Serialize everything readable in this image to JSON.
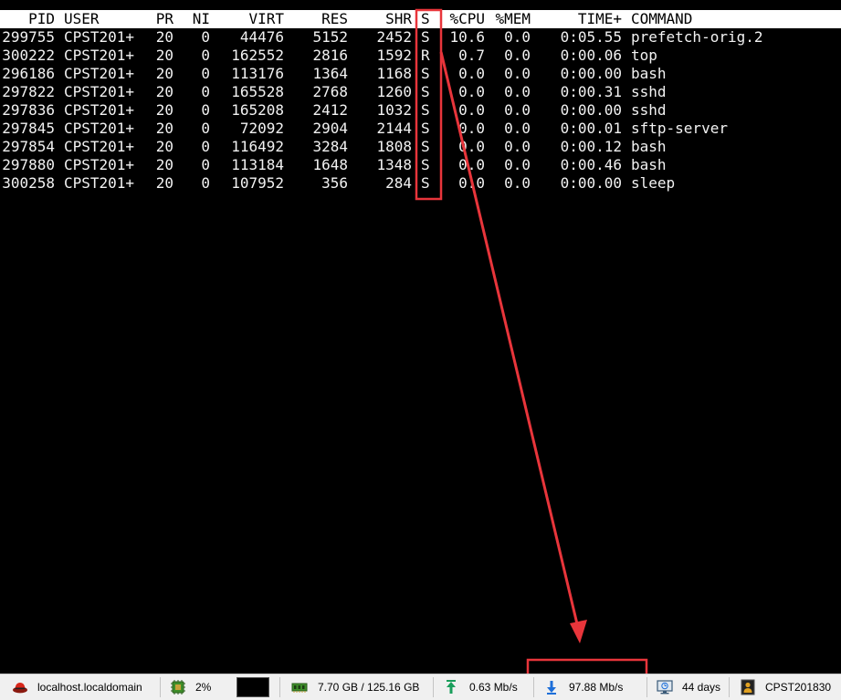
{
  "terminal": {
    "columns": [
      "PID",
      "USER",
      "PR",
      "NI",
      "VIRT",
      "RES",
      "SHR",
      "S",
      "%CPU",
      "%MEM",
      "TIME+",
      "COMMAND"
    ],
    "processes": [
      [
        "299755",
        "CPST201+",
        "20",
        "0",
        "44476",
        "5152",
        "2452",
        "S",
        "10.6",
        "0.0",
        "0:05.55",
        "prefetch-orig.2"
      ],
      [
        "300222",
        "CPST201+",
        "20",
        "0",
        "162552",
        "2816",
        "1592",
        "R",
        "0.7",
        "0.0",
        "0:00.06",
        "top"
      ],
      [
        "296186",
        "CPST201+",
        "20",
        "0",
        "113176",
        "1364",
        "1168",
        "S",
        "0.0",
        "0.0",
        "0:00.00",
        "bash"
      ],
      [
        "297822",
        "CPST201+",
        "20",
        "0",
        "165528",
        "2768",
        "1260",
        "S",
        "0.0",
        "0.0",
        "0:00.31",
        "sshd"
      ],
      [
        "297836",
        "CPST201+",
        "20",
        "0",
        "165208",
        "2412",
        "1032",
        "S",
        "0.0",
        "0.0",
        "0:00.00",
        "sshd"
      ],
      [
        "297845",
        "CPST201+",
        "20",
        "0",
        "72092",
        "2904",
        "2144",
        "S",
        "0.0",
        "0.0",
        "0:00.01",
        "sftp-server"
      ],
      [
        "297854",
        "CPST201+",
        "20",
        "0",
        "116492",
        "3284",
        "1808",
        "S",
        "0.0",
        "0.0",
        "0:00.12",
        "bash"
      ],
      [
        "297880",
        "CPST201+",
        "20",
        "0",
        "113184",
        "1648",
        "1348",
        "S",
        "0.0",
        "0.0",
        "0:00.46",
        "bash"
      ],
      [
        "300258",
        "CPST201+",
        "20",
        "0",
        "107952",
        "356",
        "284",
        "S",
        "0.0",
        "0.0",
        "0:00.00",
        "sleep"
      ]
    ]
  },
  "statusbar": {
    "host": "localhost.localdomain",
    "cpu": "2%",
    "memory": "7.70 GB / 125.16 GB",
    "upload": "0.63 Mb/s",
    "download": "97.88 Mb/s",
    "uptime": "44 days",
    "session": "CPST201830"
  },
  "icons": {
    "host": "redhat-icon",
    "cpu": "cpu-chip-icon",
    "memory": "memory-ram-icon",
    "upload": "upload-arrow-icon",
    "download": "download-arrow-icon",
    "uptime": "monitor-uptime-icon",
    "session": "user-session-icon"
  },
  "colors": {
    "terminal_bg": "#000000",
    "terminal_fg": "#f2f2f2",
    "header_bg": "#ffffff",
    "annotation": "#e8353b",
    "upload_arrow": "#1a9e5c",
    "download_arrow": "#1e6fd9"
  }
}
